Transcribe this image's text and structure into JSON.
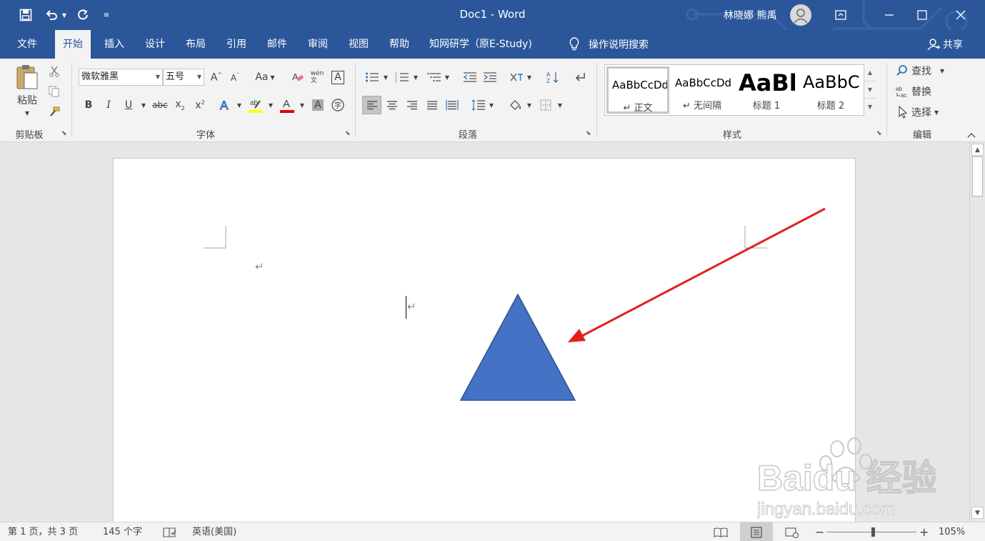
{
  "window": {
    "title": "Doc1 - Word",
    "user_name": "林晓娜 熊禹"
  },
  "tabs": [
    {
      "label": "文件"
    },
    {
      "label": "开始"
    },
    {
      "label": "插入"
    },
    {
      "label": "设计"
    },
    {
      "label": "布局"
    },
    {
      "label": "引用"
    },
    {
      "label": "邮件"
    },
    {
      "label": "审阅"
    },
    {
      "label": "视图"
    },
    {
      "label": "帮助"
    },
    {
      "label": "知网研学（原E-Study)"
    }
  ],
  "tell_me": "操作说明搜索",
  "share": "共享",
  "clipboard": {
    "paste_label": "粘贴",
    "group_label": "剪贴板"
  },
  "font": {
    "name": "微软雅黑",
    "size": "五号",
    "group_label": "字体",
    "case_label": "Aa"
  },
  "paragraph": {
    "group_label": "段落"
  },
  "styles": {
    "group_label": "样式",
    "items": [
      {
        "sample": "AaBbCcDd",
        "name": "↵ 正文"
      },
      {
        "sample": "AaBbCcDd",
        "name": "↵ 无间隔"
      },
      {
        "sample": "AaBl",
        "name": "标题 1"
      },
      {
        "sample": "AaBbC",
        "name": "标题 2"
      }
    ]
  },
  "editing": {
    "find": "查找",
    "replace": "替换",
    "select": "选择",
    "group_label": "编辑"
  },
  "document": {
    "paragraph_mark": "↵"
  },
  "status": {
    "page": "第 1 页，共 3 页",
    "words": "145 个字",
    "language": "英语(美国)",
    "zoom": "105%",
    "zoom_fraction": 0.52
  },
  "colors": {
    "accent": "#2b579a",
    "triangle_fill": "#4472c4",
    "triangle_stroke": "#2f528f",
    "arrow": "#e0201f",
    "highlight": "#ffff00",
    "font_color": "#e00000"
  },
  "watermark": {
    "brand": "Baidu 经验",
    "url": "jingyan.baidu.com"
  }
}
